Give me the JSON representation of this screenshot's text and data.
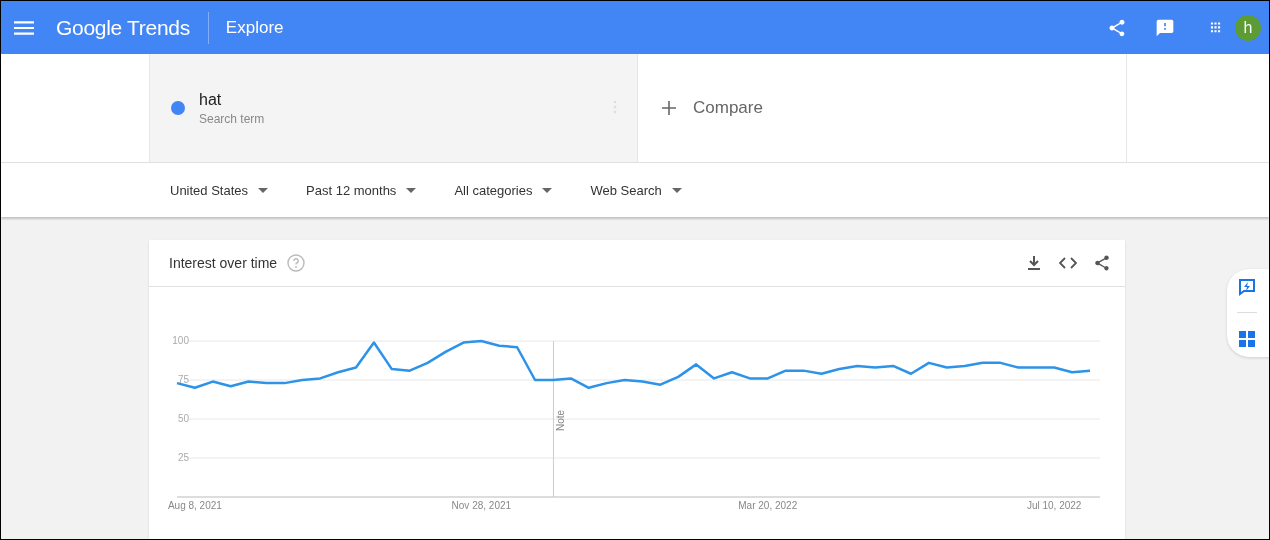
{
  "header": {
    "logo": "Google Trends",
    "title": "Explore",
    "avatar": "h"
  },
  "terms": [
    {
      "term": "hat",
      "subtitle": "Search term",
      "color": "#4285f4"
    }
  ],
  "compare": {
    "label": "Compare"
  },
  "filters": [
    "United States",
    "Past 12 months",
    "All categories",
    "Web Search"
  ],
  "interest_over_time": {
    "title": "Interest over time",
    "chart_data": {
      "type": "line",
      "categories": [
        null,
        "Aug 8, 2021",
        null,
        null,
        null,
        null,
        null,
        null,
        null,
        null,
        null,
        null,
        null,
        null,
        null,
        null,
        null,
        "Nov 28, 2021",
        null,
        null,
        null,
        null,
        null,
        null,
        null,
        null,
        null,
        null,
        null,
        null,
        null,
        null,
        null,
        "Mar 20, 2022",
        null,
        null,
        null,
        null,
        null,
        null,
        null,
        null,
        null,
        null,
        null,
        null,
        null,
        null,
        null,
        "Jul 10, 2022",
        null,
        null
      ],
      "series": [
        {
          "color": "#2d93e8",
          "values": [
            73,
            70,
            74,
            71,
            74,
            73,
            73,
            75,
            76,
            80,
            83,
            99,
            82,
            81,
            86,
            93,
            99,
            100,
            97,
            96,
            75,
            75,
            76,
            70,
            73,
            75,
            74,
            72,
            77,
            85,
            76,
            80,
            76,
            76,
            81,
            81,
            79,
            82,
            84,
            83,
            84,
            79,
            86,
            83,
            84,
            86,
            86,
            83,
            83,
            83,
            80,
            81
          ]
        }
      ],
      "grid": true,
      "ylim": [
        0,
        100
      ],
      "yticks": [
        25,
        50,
        75,
        100
      ],
      "annotations": [
        "Note"
      ]
    }
  }
}
